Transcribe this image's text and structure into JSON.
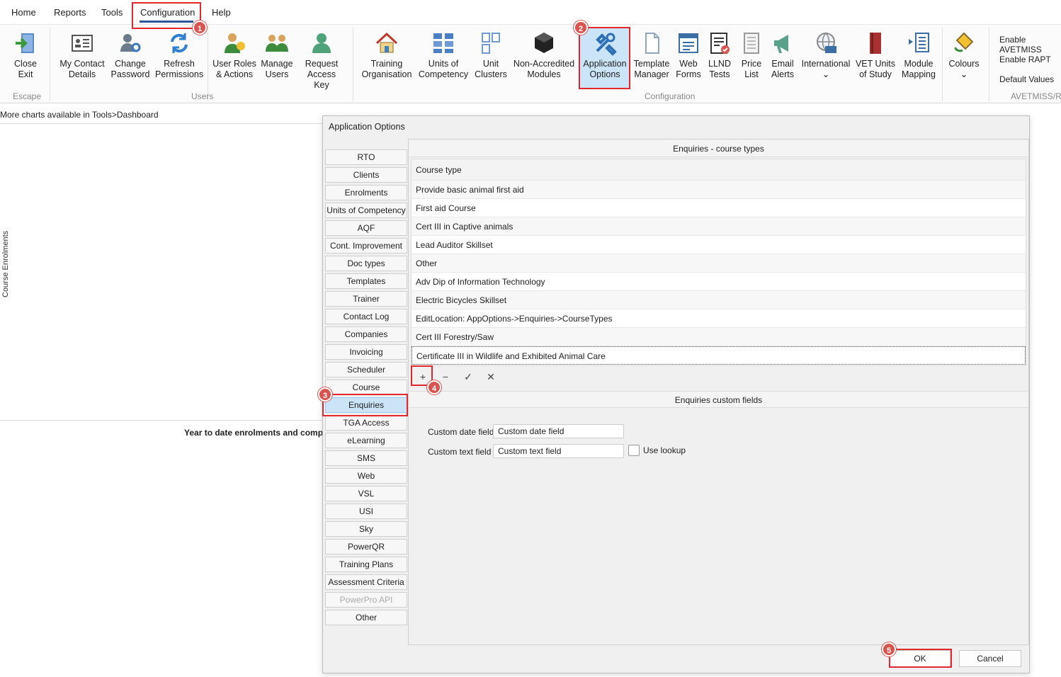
{
  "menu_tabs": [
    "Home",
    "Reports",
    "Tools",
    "Configuration",
    "Help"
  ],
  "ribbon": {
    "escape_group": "Escape",
    "users_group": "Users",
    "configuration_group": "Configuration",
    "avetmiss_group": "AVETMISS/RA",
    "close_exit": [
      "Close",
      "Exit"
    ],
    "my_contact": [
      "My Contact",
      "Details"
    ],
    "change_password": [
      "Change",
      "Password"
    ],
    "refresh_permissions": [
      "Refresh",
      "Permissions"
    ],
    "user_roles": [
      "User Roles",
      "& Actions"
    ],
    "manage_users": [
      "Manage",
      "Users"
    ],
    "request_access": [
      "Request",
      "Access Key"
    ],
    "training_org": [
      "Training",
      "Organisation"
    ],
    "units_comp": [
      "Units of",
      "Competency"
    ],
    "unit_clusters": [
      "Unit",
      "Clusters"
    ],
    "non_accredited": [
      "Non-Accredited",
      "Modules"
    ],
    "application_options": [
      "Application",
      "Options"
    ],
    "template_manager": [
      "Template",
      "Manager"
    ],
    "web_forms": [
      "Web",
      "Forms"
    ],
    "llnd_tests": [
      "LLND",
      "Tests"
    ],
    "price_list": [
      "Price",
      "List"
    ],
    "email_alerts": [
      "Email",
      "Alerts"
    ],
    "international": "International",
    "vet_units": [
      "VET Units",
      "of Study"
    ],
    "module_mapping": [
      "Module",
      "Mapping"
    ],
    "colours": "Colours",
    "enable_avetmiss": "Enable AVETMISS",
    "enable_rapt": "Enable RAPT",
    "default_values": "Default Values"
  },
  "status_text": "More charts available in Tools>Dashboard",
  "vertical_label": "Course Enrolments",
  "ytd_label": "Year to date enrolments and comp",
  "dialog": {
    "title": "Application Options",
    "nav": [
      "RTO",
      "Clients",
      "Enrolments",
      "Units of Competency",
      "AQF",
      "Cont. Improvement",
      "Doc types",
      "Templates",
      "Trainer",
      "Contact Log",
      "Companies",
      "Invoicing",
      "Scheduler",
      "Course",
      "Enquiries",
      "TGA Access",
      "eLearning",
      "SMS",
      "Web",
      "VSL",
      "USI",
      "Sky",
      "PowerQR",
      "Training Plans",
      "Assessment Criteria",
      "PowerPro API",
      "Other"
    ],
    "selected_nav": "Enquiries",
    "course_types_header": "Enquiries - course types",
    "column_header": "Course type",
    "course_types": [
      "Provide basic animal first aid",
      "First aid Course",
      "Cert III in Captive animals",
      "Lead Auditor Skillset",
      "Other",
      "Adv Dip of Information Technology",
      "Electric Bicycles Skillset",
      "EditLocation: AppOptions->Enquiries->CourseTypes",
      "Cert III Forestry/Saw",
      "Certificate III in Wildlife and Exhibited Animal Care"
    ],
    "toolbar": {
      "add": "+",
      "remove": "−",
      "confirm": "✓",
      "cancel": "✕"
    },
    "custom_fields_header": "Enquiries custom fields",
    "custom_date_label": "Custom date field",
    "custom_date_value": "Custom date field",
    "custom_text_label": "Custom text field",
    "custom_text_value": "Custom text field",
    "use_lookup_label": "Use lookup",
    "ok": "OK",
    "cancel": "Cancel"
  },
  "badges": [
    "1",
    "2",
    "3",
    "4",
    "5"
  ],
  "colors": {
    "accent_blue": "#2b579a",
    "highlight": "#e0282e",
    "selected": "#cce4f7"
  }
}
